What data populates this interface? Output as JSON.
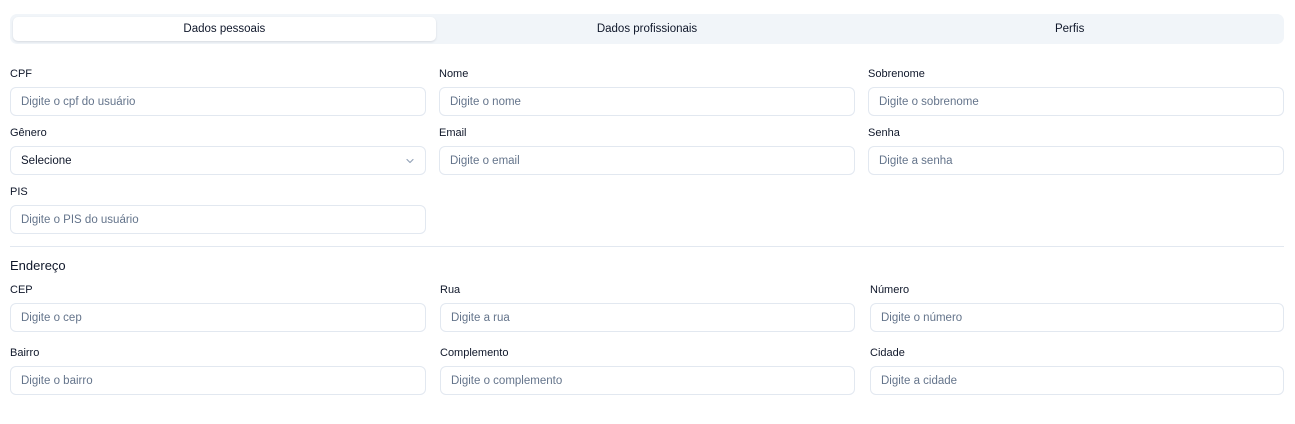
{
  "tabs": [
    {
      "label": "Dados pessoais",
      "active": true
    },
    {
      "label": "Dados profissionais",
      "active": false
    },
    {
      "label": "Perfis",
      "active": false
    }
  ],
  "personal": {
    "cpf": {
      "label": "CPF",
      "placeholder": "Digite o cpf do usuário"
    },
    "nome": {
      "label": "Nome",
      "placeholder": "Digite o nome"
    },
    "sobrenome": {
      "label": "Sobrenome",
      "placeholder": "Digite o sobrenome"
    },
    "genero": {
      "label": "Gênero",
      "value": "Selecione"
    },
    "email": {
      "label": "Email",
      "placeholder": "Digite o email"
    },
    "senha": {
      "label": "Senha",
      "placeholder": "Digite a senha"
    },
    "pis": {
      "label": "PIS",
      "placeholder": "Digite o PIS do usuário"
    }
  },
  "address": {
    "title": "Endereço",
    "cep": {
      "label": "CEP",
      "placeholder": "Digite o cep"
    },
    "rua": {
      "label": "Rua",
      "placeholder": "Digite a rua"
    },
    "numero": {
      "label": "Número",
      "placeholder": "Digite o número"
    },
    "bairro": {
      "label": "Bairro",
      "placeholder": "Digite o bairro"
    },
    "complemento": {
      "label": "Complemento",
      "placeholder": "Digite o complemento"
    },
    "cidade": {
      "label": "Cidade",
      "placeholder": "Digite a cidade"
    }
  },
  "colors": {
    "border": "#e2e8f0",
    "tab_bg": "#f1f5f9",
    "placeholder": "#64748b",
    "text": "#0f172a"
  },
  "icons": {
    "select_chevron": "chevron-down-icon"
  }
}
